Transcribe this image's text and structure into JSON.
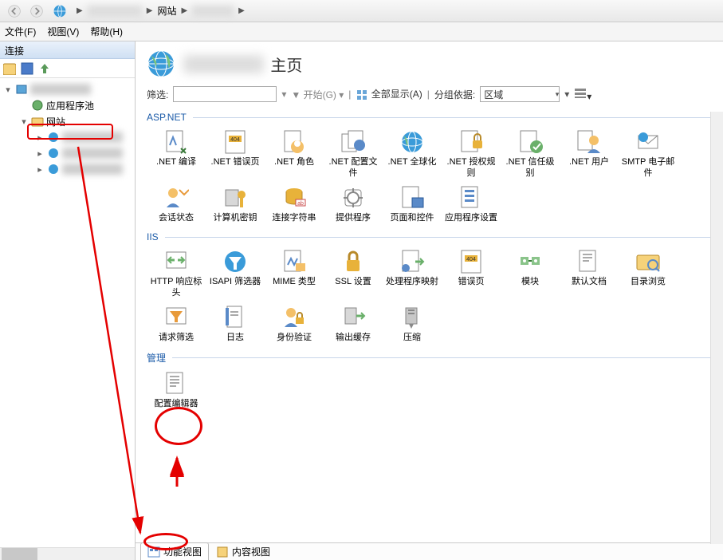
{
  "nav": {
    "breadcrumb1": "网站"
  },
  "menu": {
    "file": "文件(F)",
    "view": "视图(V)",
    "help": "帮助(H)"
  },
  "conn": {
    "title": "连接",
    "appPools": "应用程序池",
    "sites": "网站"
  },
  "page": {
    "title_suffix": "主页",
    "filter_label": "筛选:",
    "start_label": "开始(G)",
    "showall_label": "全部显示(A)",
    "groupby_label": "分组依据:",
    "groupby_value": "区域"
  },
  "sections": {
    "aspnet": "ASP.NET",
    "iis": "IIS",
    "mgmt": "管理"
  },
  "features": {
    "aspnet": [
      ".NET 编译",
      ".NET 错误页",
      ".NET 角色",
      ".NET 配置文件",
      ".NET 全球化",
      ".NET 授权规则",
      ".NET 信任级别",
      ".NET 用户",
      "SMTP 电子邮件",
      "会话状态",
      "计算机密钥",
      "连接字符串",
      "提供程序",
      "页面和控件",
      "应用程序设置"
    ],
    "iis": [
      "HTTP 响应标头",
      "ISAPI 筛选器",
      "MIME 类型",
      "SSL 设置",
      "处理程序映射",
      "错误页",
      "模块",
      "默认文档",
      "目录浏览",
      "请求筛选",
      "日志",
      "身份验证",
      "输出缓存",
      "压缩"
    ],
    "mgmt": [
      "配置编辑器"
    ]
  },
  "tabs": {
    "features": "功能视图",
    "content": "内容视图"
  }
}
